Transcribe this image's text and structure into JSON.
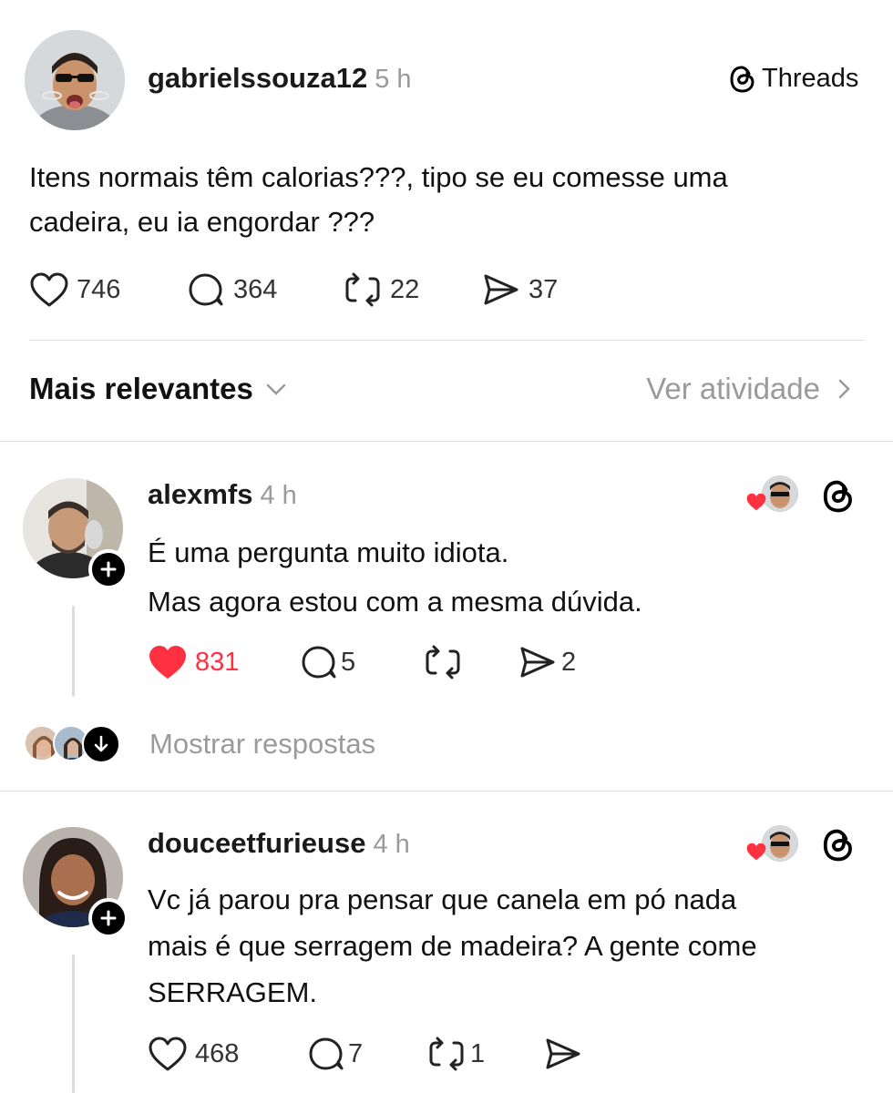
{
  "post": {
    "username": "gabrielssouza12",
    "time": "5 h",
    "text_line1": "Itens normais têm calorias???, tipo se eu comesse uma",
    "text_line2": "cadeira, eu ia engordar ???",
    "likes": "746",
    "replies": "364",
    "reposts": "22",
    "shares": "37"
  },
  "brand": {
    "label": "Threads"
  },
  "sort": {
    "label": "Mais relevantes",
    "activity_label": "Ver atividade"
  },
  "comments": [
    {
      "username": "alexmfs",
      "time": "4 h",
      "line1": "É uma pergunta muito idiota.",
      "line2": "Mas agora estou com a mesma dúvida.",
      "likes": "831",
      "liked": true,
      "replies": "5",
      "reposts": "",
      "shares": "2",
      "show_replies_label": "Mostrar respostas"
    },
    {
      "username": "douceetfurieuse",
      "time": "4 h",
      "line1": "Vc já parou pra pensar que canela em pó nada",
      "line2": "mais é que serragem de madeira? A gente come",
      "line3": "SERRAGEM.",
      "likes": "468",
      "liked": false,
      "replies": "7",
      "reposts": "1",
      "shares": ""
    }
  ],
  "colors": {
    "liked_red": "#ff3040",
    "muted": "#9a9a9a",
    "divider": "#e0e0e0"
  },
  "icons": [
    "heart-icon",
    "comment-icon",
    "repost-icon",
    "share-icon",
    "threads-logo-icon",
    "plus-icon",
    "chevron-down-icon",
    "chevron-right-icon",
    "arrow-down-icon"
  ]
}
